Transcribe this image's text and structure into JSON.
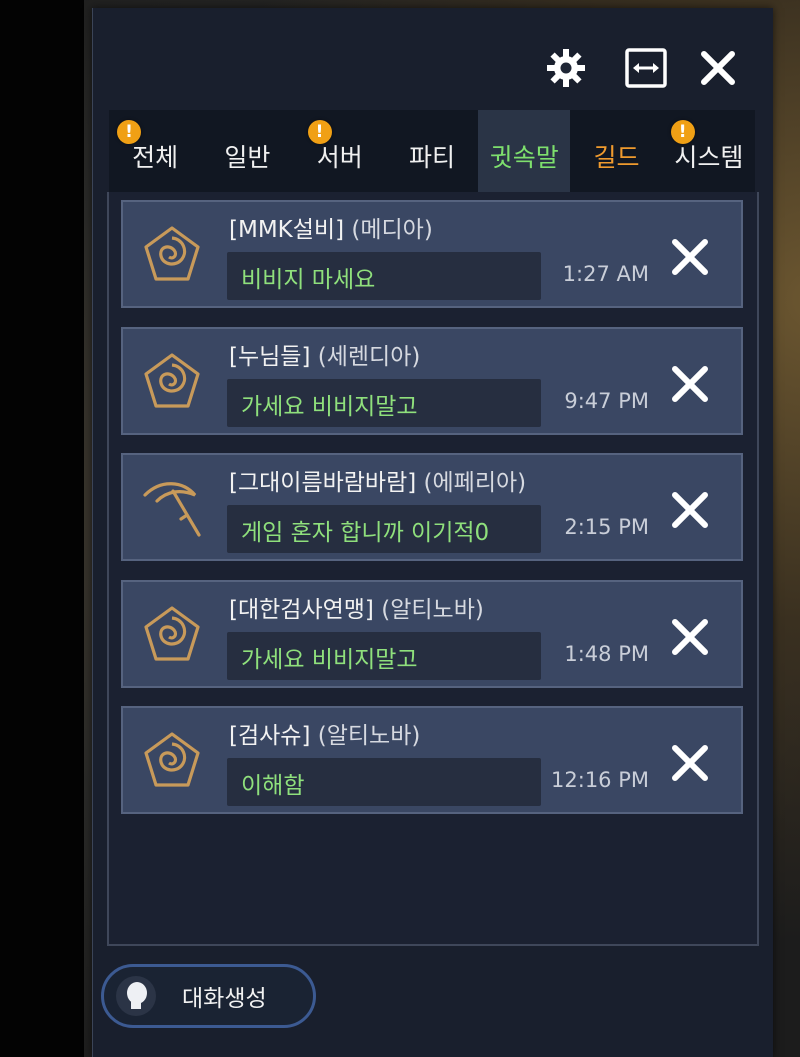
{
  "header": {
    "settings_icon": "gear-icon",
    "resize_icon": "expand-horizontal-icon",
    "close_icon": "close-icon"
  },
  "tabs": [
    {
      "label": "전체",
      "alert": true
    },
    {
      "label": "일반",
      "alert": false
    },
    {
      "label": "서버",
      "alert": true
    },
    {
      "label": "파티",
      "alert": false
    },
    {
      "label": "귓속말",
      "alert": false,
      "active": true
    },
    {
      "label": "길드",
      "alert": false
    },
    {
      "label": "시스템",
      "alert": true
    }
  ],
  "alert_symbol": "!",
  "conversations": [
    {
      "name": "[MMK설비]",
      "server": "(메디아)",
      "message": "비비지 마세요",
      "time": "1:27 AM",
      "icon": "rose-emblem-icon"
    },
    {
      "name": "[누님들]",
      "server": "(세렌디아)",
      "message": "가세요 비비지말고",
      "time": "9:47 PM",
      "icon": "rose-emblem-icon"
    },
    {
      "name": "[그대이름바람바람]",
      "server": "(에페리아)",
      "message": "게임 혼자 합니까 이기적0",
      "time": "2:15 PM",
      "icon": "scythe-icon"
    },
    {
      "name": "[대한검사연맹]",
      "server": "(알티노바)",
      "message": "가세요 비비지말고",
      "time": "1:48 PM",
      "icon": "rose-emblem-icon"
    },
    {
      "name": "[검사슈]",
      "server": "(알티노바)",
      "message": "이해함",
      "time": "12:16 PM",
      "icon": "rose-emblem-icon"
    }
  ],
  "create_button": {
    "label": "대화생성",
    "icon": "user-silhouette-icon"
  },
  "colors": {
    "active_tab_text": "#7ee06d",
    "guild_tab_text": "#ef9a2e",
    "message_text": "#8fe07c",
    "alert_badge": "#f0a015",
    "icon_gold": "#c89a5a"
  }
}
